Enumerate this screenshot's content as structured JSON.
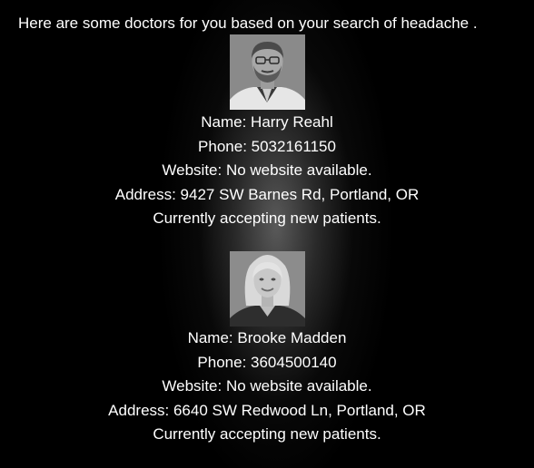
{
  "intro": {
    "message": "Here are some doctors for you based on your search of headache ."
  },
  "doctors": [
    {
      "photo_icon": "doctor-photo-male",
      "name_line": "Name: Harry Reahl",
      "phone_line": "Phone: 5032161150",
      "website_line": "Website: No website available.",
      "address_line": "Address: 9427 SW Barnes Rd, Portland, OR",
      "status_line": "Currently accepting new patients."
    },
    {
      "photo_icon": "doctor-photo-female",
      "name_line": "Name: Brooke Madden",
      "phone_line": "Phone: 3604500140",
      "website_line": "Website: No website available.",
      "address_line": "Address: 6640 SW Redwood Ln, Portland, OR",
      "status_line": "Currently accepting new patients."
    }
  ],
  "colors": {
    "background": "#000000",
    "text": "#ffffff",
    "glow": "#5f5f5f"
  }
}
